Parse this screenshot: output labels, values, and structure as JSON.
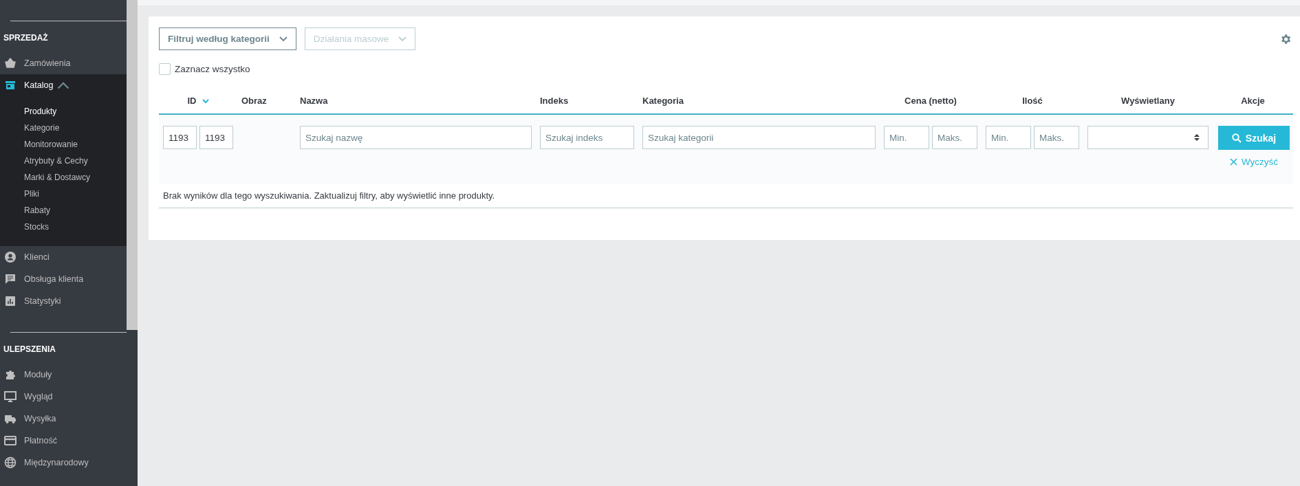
{
  "sidebar": {
    "sections": [
      {
        "title": "SPRZEDAŻ",
        "items": [
          {
            "label": "Zamówienia",
            "selected": false
          },
          {
            "label": "Katalog",
            "selected": true,
            "expanded": true,
            "children": [
              {
                "label": "Produkty",
                "selected": true
              },
              {
                "label": "Kategorie",
                "selected": false
              },
              {
                "label": "Monitorowanie",
                "selected": false
              },
              {
                "label": "Atrybuty & Cechy",
                "selected": false
              },
              {
                "label": "Marki & Dostawcy",
                "selected": false
              },
              {
                "label": "Pliki",
                "selected": false
              },
              {
                "label": "Rabaty",
                "selected": false
              },
              {
                "label": "Stocks",
                "selected": false
              }
            ]
          },
          {
            "label": "Klienci",
            "selected": false
          },
          {
            "label": "Obsługa klienta",
            "selected": false
          },
          {
            "label": "Statystyki",
            "selected": false
          }
        ]
      },
      {
        "title": "ULEPSZENIA",
        "items": [
          {
            "label": "Moduły",
            "selected": false
          },
          {
            "label": "Wygląd",
            "selected": false
          },
          {
            "label": "Wysyłka",
            "selected": false
          },
          {
            "label": "Płatność",
            "selected": false
          },
          {
            "label": "Międzynarodowy",
            "selected": false
          }
        ]
      }
    ]
  },
  "toolbar": {
    "dropdowns": [
      {
        "label": "Filtruj według kategorii",
        "disabled": false
      },
      {
        "label": "Działania masowe",
        "disabled": true
      }
    ],
    "select_all": {
      "label": "Zaznacz wszystko",
      "checked": false
    }
  },
  "table": {
    "columns": [
      {
        "label": "ID",
        "sorted": true
      },
      {
        "label": "Obraz",
        "sorted": false
      },
      {
        "label": "Nazwa",
        "sorted": false
      },
      {
        "label": "Indeks",
        "sorted": false
      },
      {
        "label": "Kategoria",
        "sorted": false
      },
      {
        "label": "Cena (netto)",
        "sorted": false
      },
      {
        "label": "Ilość",
        "sorted": false
      },
      {
        "label": "Wyświetlany",
        "sorted": false
      },
      {
        "label": "Akcje",
        "sorted": false
      }
    ],
    "filters": [
      {
        "kind": "range",
        "fields": [
          {
            "value": "1193"
          },
          {
            "value": "1193"
          }
        ]
      },
      {
        "kind": "blank"
      },
      {
        "kind": "text",
        "placeholder": "Szukaj nazwę"
      },
      {
        "kind": "text",
        "placeholder": "Szukaj indeks"
      },
      {
        "kind": "text",
        "placeholder": "Szukaj kategorii"
      },
      {
        "kind": "range",
        "fields": [
          {
            "placeholder": "Min."
          },
          {
            "placeholder": "Maks."
          }
        ]
      },
      {
        "kind": "range",
        "fields": [
          {
            "placeholder": "Min."
          },
          {
            "placeholder": "Maks."
          }
        ]
      },
      {
        "kind": "select"
      },
      {
        "kind": "actions",
        "search_label": "Szukaj",
        "reset_label": "Wyczyść"
      }
    ],
    "empty_message": "Brak wyników dla tego wyszukiwania. Zaktualizuj filtry, aby wyświetlić inne produkty."
  }
}
